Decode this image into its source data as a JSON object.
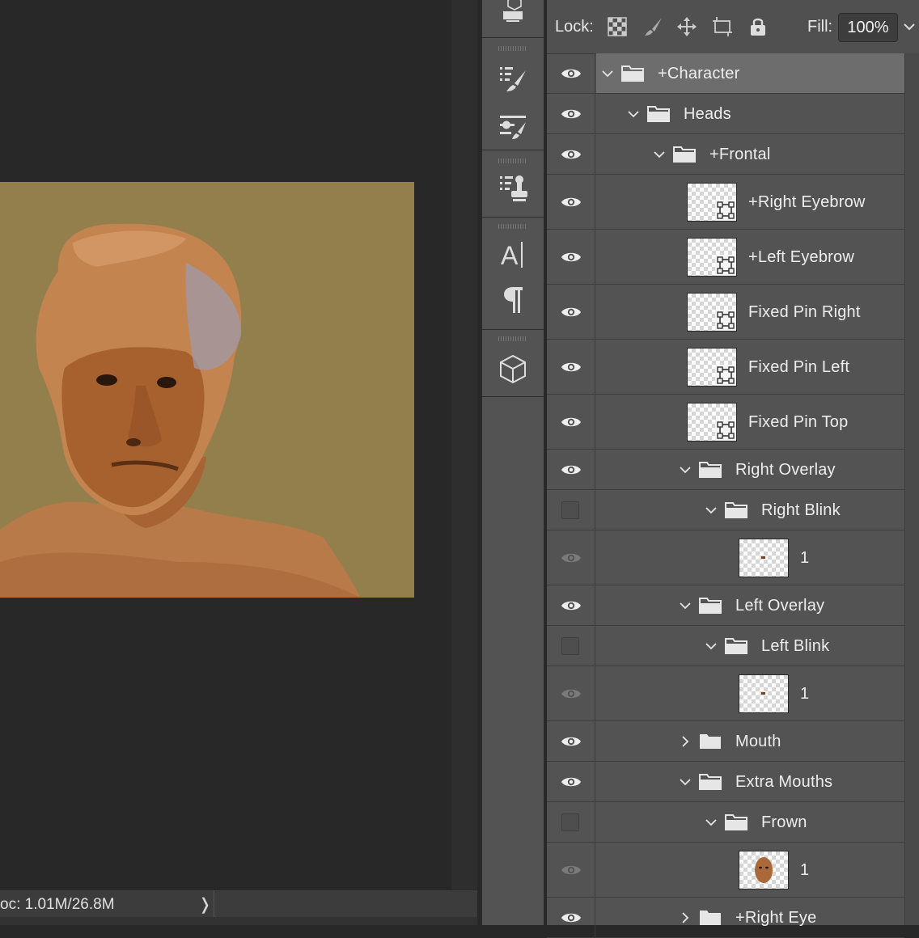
{
  "status_bar": {
    "doc_text": "oc: 1.01M/26.8M",
    "arrow_glyph": "❭"
  },
  "artwork": {
    "background_color": "#927f4c",
    "subject_color": "#b87a47"
  },
  "tools": [
    "3d-material-icon",
    "brush-settings-icon",
    "brush-presets-icon",
    "clone-source-icon",
    "character-icon",
    "paragraph-icon",
    "3d-icon"
  ],
  "layers_panel": {
    "lock_label": "Lock:",
    "fill_label": "Fill:",
    "fill_value": "100%",
    "layers": [
      {
        "name": "+Character",
        "type": "group",
        "expanded": true,
        "visible": true,
        "selected": true
      },
      {
        "name": "Heads",
        "type": "group",
        "expanded": true,
        "visible": true
      },
      {
        "name": "+Frontal",
        "type": "group",
        "expanded": true,
        "visible": true
      },
      {
        "name": "+Right Eyebrow",
        "type": "smart-object",
        "visible": true
      },
      {
        "name": "+Left Eyebrow",
        "type": "smart-object",
        "visible": true
      },
      {
        "name": "Fixed Pin Right",
        "type": "smart-object",
        "visible": true
      },
      {
        "name": "Fixed Pin Left",
        "type": "smart-object",
        "visible": true
      },
      {
        "name": "Fixed Pin Top",
        "type": "smart-object",
        "visible": true
      },
      {
        "name": "Right Overlay",
        "type": "group",
        "expanded": true,
        "visible": true
      },
      {
        "name": "Right Blink",
        "type": "group",
        "expanded": true,
        "visible": false
      },
      {
        "name": "1",
        "type": "layer",
        "visible": "dimmed"
      },
      {
        "name": "Left Overlay",
        "type": "group",
        "expanded": true,
        "visible": true
      },
      {
        "name": "Left Blink",
        "type": "group",
        "expanded": true,
        "visible": false
      },
      {
        "name": "1",
        "type": "layer",
        "visible": "dimmed"
      },
      {
        "name": "Mouth",
        "type": "group",
        "expanded": false,
        "visible": true
      },
      {
        "name": "Extra Mouths",
        "type": "group",
        "expanded": true,
        "visible": true
      },
      {
        "name": "Frown",
        "type": "group",
        "expanded": true,
        "visible": false
      },
      {
        "name": "1",
        "type": "layer",
        "visible": "dimmed"
      },
      {
        "name": "+Right Eye",
        "type": "group",
        "expanded": false,
        "visible": true
      }
    ]
  }
}
